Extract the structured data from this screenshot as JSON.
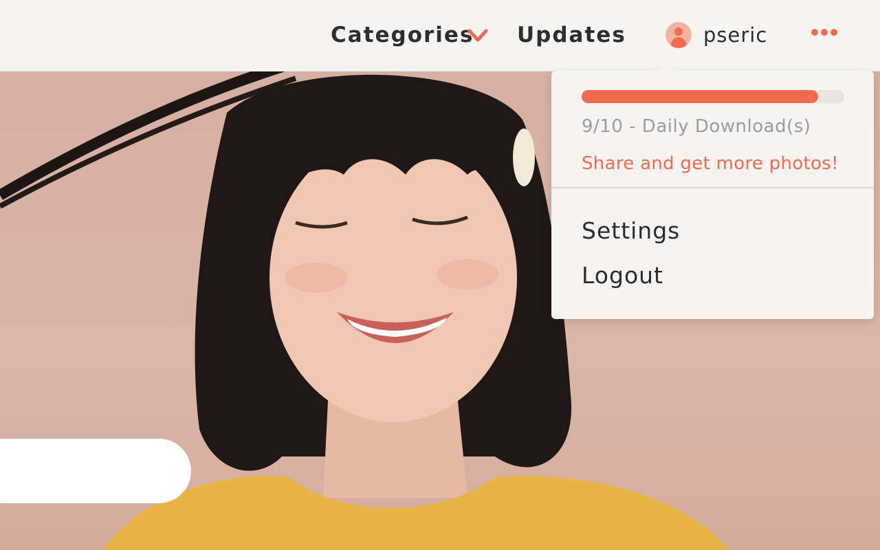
{
  "nav": {
    "categories_label": "Categories",
    "categories_icon": "chevron-down-icon",
    "updates_label": "Updates",
    "username": "pseric",
    "user_icon": "user-avatar-icon",
    "more_icon": "more-dots-icon"
  },
  "user_menu": {
    "download_progress": 0.9,
    "download_text": "9/10 - Daily Download(s)",
    "share_link": "Share and get more photos!",
    "items": [
      {
        "label": "Settings"
      },
      {
        "label": "Logout"
      }
    ]
  },
  "colors": {
    "accent": "#f26a4d",
    "nav_background": "#f5f4f2",
    "muted_text": "#9c9c9c",
    "text": "#2e2e2e"
  }
}
